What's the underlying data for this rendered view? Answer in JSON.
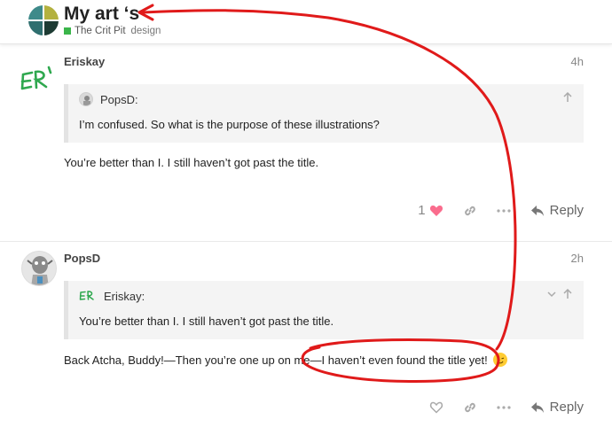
{
  "header": {
    "topic_title": "My art ‘s",
    "category": "The Crit Pit",
    "tag": "design",
    "category_color": "#3ab54a"
  },
  "posts": [
    {
      "username": "Eriskay",
      "date": "4h",
      "avatar_icon": "er-logo-avatar",
      "quote": {
        "author": "PopsD:",
        "text": "I’m confused. So what is the purpose of these illustrations?"
      },
      "body": "You’re better than I. I still haven’t got past the title.",
      "likes": "1",
      "reply_label": "Reply"
    },
    {
      "username": "PopsD",
      "date": "2h",
      "avatar_icon": "cartoon-avatar",
      "quote": {
        "author": "Eriskay:",
        "text": "You’re better than I. I still haven’t got past the title."
      },
      "body": "Back Atcha, Buddy!—Then you’re one up on me—I haven’t even found the title yet!",
      "reply_label": "Reply"
    }
  ],
  "colors": {
    "annotation": "#e01a1a",
    "like_heart": "#fa6c8d",
    "accent": "#3ab54a"
  }
}
